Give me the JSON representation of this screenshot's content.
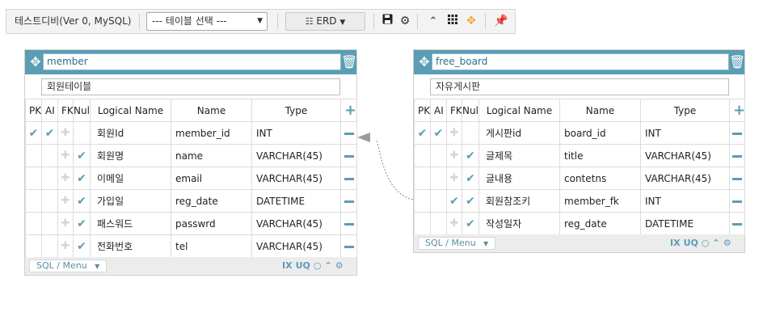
{
  "toolbar": {
    "db_title": "테스트디비(Ver 0, MySQL)",
    "table_select": "--- 테이블 선택 ---",
    "erd_button": "ERD",
    "icons": [
      "save-icon",
      "gear-icon",
      "collapse-icon",
      "grid-icon",
      "move-icon",
      "pin-icon"
    ]
  },
  "column_headers": {
    "pk": "PK",
    "ai": "AI",
    "fk": "FK",
    "null": "Null",
    "logical": "Logical Name",
    "name": "Name",
    "type": "Type"
  },
  "tables": [
    {
      "name": "member",
      "comment": "회원테이블",
      "columns": [
        {
          "logical": "회원Id",
          "name": "member_id",
          "type": "INT",
          "pk": true,
          "ai": true,
          "fk": false,
          "notnull": false
        },
        {
          "logical": "회원명",
          "name": "name",
          "type": "VARCHAR(45)",
          "pk": false,
          "ai": false,
          "fk": false,
          "notnull": true
        },
        {
          "logical": "이메일",
          "name": "email",
          "type": "VARCHAR(45)",
          "pk": false,
          "ai": false,
          "fk": false,
          "notnull": true
        },
        {
          "logical": "가입일",
          "name": "reg_date",
          "type": "DATETIME",
          "pk": false,
          "ai": false,
          "fk": false,
          "notnull": true
        },
        {
          "logical": "패스워드",
          "name": "passwrd",
          "type": "VARCHAR(45)",
          "pk": false,
          "ai": false,
          "fk": false,
          "notnull": true
        },
        {
          "logical": "전화번호",
          "name": "tel",
          "type": "VARCHAR(45)",
          "pk": false,
          "ai": false,
          "fk": false,
          "notnull": true
        }
      ],
      "sql_menu": "SQL / Menu",
      "footer_labels": {
        "ix": "IX",
        "uq": "UQ"
      }
    },
    {
      "name": "free_board",
      "comment": "자유게시판",
      "columns": [
        {
          "logical": "게시판id",
          "name": "board_id",
          "type": "INT",
          "pk": true,
          "ai": true,
          "fk": false,
          "notnull": false
        },
        {
          "logical": "글제목",
          "name": "title",
          "type": "VARCHAR(45)",
          "pk": false,
          "ai": false,
          "fk": false,
          "notnull": true
        },
        {
          "logical": "글내용",
          "name": "contetns",
          "type": "VARCHAR(45)",
          "pk": false,
          "ai": false,
          "fk": false,
          "notnull": true
        },
        {
          "logical": "회원참조키",
          "name": "member_fk",
          "type": "INT",
          "pk": false,
          "ai": false,
          "fk": true,
          "notnull": true
        },
        {
          "logical": "작성일자",
          "name": "reg_date",
          "type": "DATETIME",
          "pk": false,
          "ai": false,
          "fk": false,
          "notnull": true
        }
      ],
      "sql_menu": "SQL / Menu",
      "footer_labels": {
        "ix": "IX",
        "uq": "UQ"
      }
    }
  ],
  "colors": {
    "accent": "#5a9db4",
    "toolbar_bg": "#f3f3f3",
    "pin": "#f0a830"
  }
}
